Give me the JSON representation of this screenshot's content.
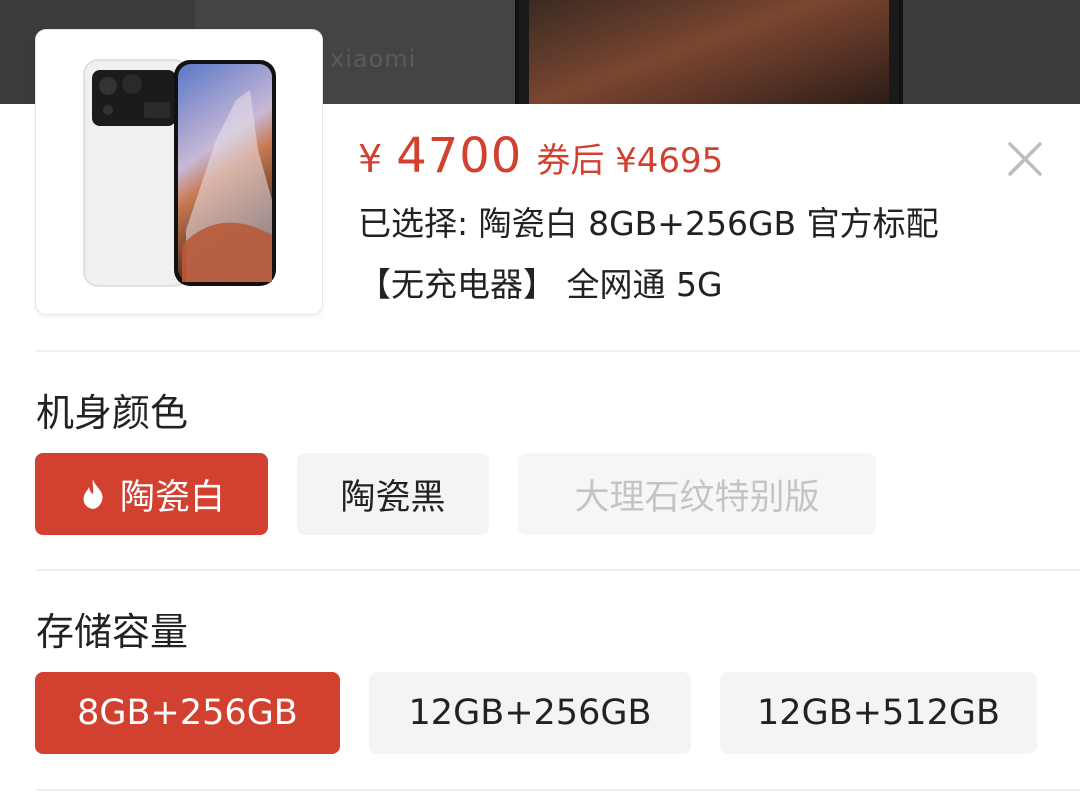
{
  "backdrop": {
    "brand_text": "xiaomi"
  },
  "product": {
    "currency": "¥",
    "price": "4700",
    "coupon_price": "券后 ¥4695",
    "selected_line1": "已选择: 陶瓷白 8GB+256GB 官方标配",
    "selected_line2": "【无充电器】 全网通 5G",
    "image_icon": "phone-image"
  },
  "color_section": {
    "title": "机身颜色",
    "options": [
      {
        "label": "陶瓷白",
        "state": "selected",
        "icon": "fire-icon"
      },
      {
        "label": "陶瓷黑",
        "state": "normal"
      },
      {
        "label": "大理石纹特别版",
        "state": "disabled"
      }
    ]
  },
  "storage_section": {
    "title": "存储容量",
    "options": [
      {
        "label": "8GB+256GB",
        "state": "selected"
      },
      {
        "label": "12GB+256GB",
        "state": "normal"
      },
      {
        "label": "12GB+512GB",
        "state": "normal"
      }
    ]
  },
  "colors": {
    "accent": "#d2402f",
    "chip_bg": "#f4f4f4",
    "disabled_text": "#c4c4c4"
  }
}
